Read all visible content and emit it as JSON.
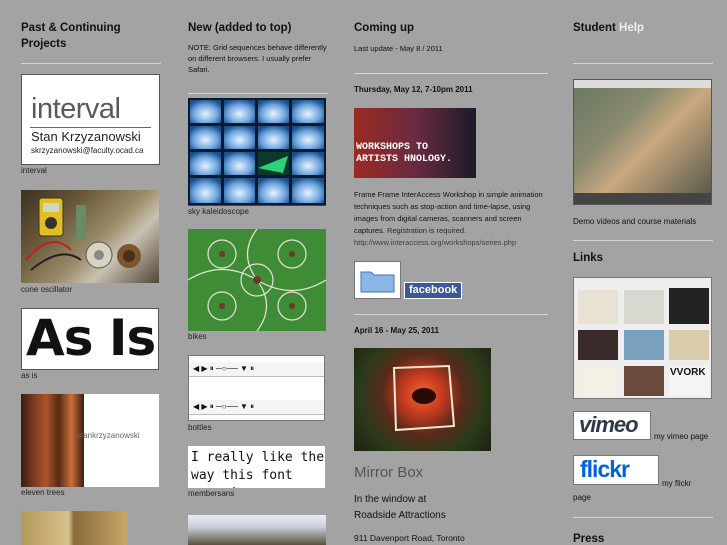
{
  "columns": {
    "past": {
      "title": "Past & Continuing Projects",
      "items": [
        {
          "caption": "interval"
        },
        {
          "caption": "cone oscillator"
        },
        {
          "caption": "as is"
        },
        {
          "caption": "eleven trees"
        }
      ],
      "interval_card": {
        "big": "interval",
        "name": "Stan Krzyzanowski",
        "email": "skrzyzanowski@faculty.ocad.ca"
      },
      "as_is_text": "As Is",
      "eleven_trees_text": "stankrzyzanowski"
    },
    "new": {
      "title": "New (added to top)",
      "note": "NOTE: Grid sequences behave differently on different browsers. I usually prefer Safari.",
      "items": [
        {
          "caption": "sky kaleidoscope"
        },
        {
          "caption": "bikes"
        },
        {
          "caption": "bottles"
        },
        {
          "caption": "membersans"
        }
      ],
      "font_sample": "I really like the way this font moves!"
    },
    "coming": {
      "title": "Coming up",
      "last_update": "Last update - May 8 / 2011",
      "event1": {
        "date": "Thursday, May 12, 7-10pm 2011",
        "banner": "WORKSHOPS TO ARTISTS HNOLOGY.",
        "desc_lead": "Frame Frame InterAccess Workshop in simple animation techniques such as stop-action and time-lapse, using images from digital cameras, scanners and screen captures.",
        "desc_link": "Registration is required.",
        "url": "http://www.interaccess.org/workshops/series.php",
        "facebook": "facebook"
      },
      "event2": {
        "date": "April 16 - May 25, 2011",
        "title": "Mirror Box",
        "line1": "In the window at",
        "line2": "Roadside Attractions",
        "address": "911 Davenport Road, Toronto"
      }
    },
    "student": {
      "title_a": "Student",
      "title_b": "Help",
      "demo_caption": "Demo videos and course materials",
      "links_title": "Links",
      "vvork": "VVORK",
      "vimeo_logo": "vimeo",
      "vimeo_caption": "my vimeo page",
      "flickr_logo": "flickr",
      "flickr_caption": "my flickr page",
      "press_title": "Press"
    }
  },
  "colors": {
    "background": "#a3a3a3",
    "rule": "#d7d7d7",
    "help": "#eeeeee",
    "facebook": "#3b5998",
    "flickr_pink": "#ff0084",
    "flickr_blue": "#0063dc"
  }
}
